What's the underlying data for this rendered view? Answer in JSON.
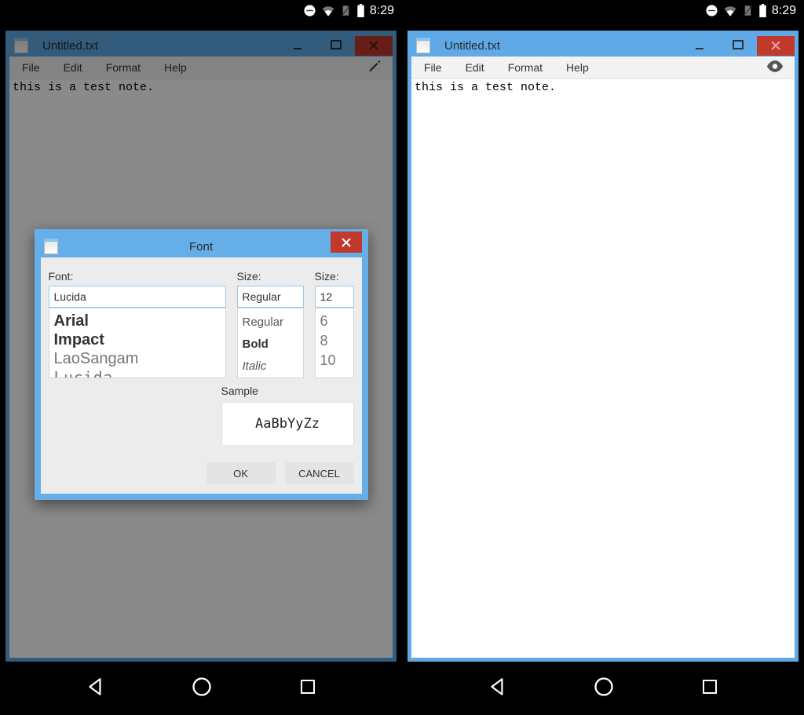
{
  "status": {
    "time": "8:29"
  },
  "notepad": {
    "title": "Untitled.txt",
    "menus": {
      "file": "File",
      "edit": "Edit",
      "format": "Format",
      "help": "Help"
    },
    "body": "this is a test note."
  },
  "font_dialog": {
    "title": "Font",
    "labels": {
      "font": "Font:",
      "style": "Size:",
      "size": "Size:",
      "sample": "Sample"
    },
    "inputs": {
      "font": "Lucida",
      "style": "Regular",
      "size": "12"
    },
    "font_list": [
      "Arial",
      "Impact",
      "LaoSangam",
      "Lucida"
    ],
    "style_list": [
      "Regular",
      "Bold",
      "Italic"
    ],
    "size_list": [
      "6",
      "8",
      "10"
    ],
    "sample_text": "AaBbYyZz",
    "buttons": {
      "ok": "OK",
      "cancel": "CANCEL"
    }
  }
}
